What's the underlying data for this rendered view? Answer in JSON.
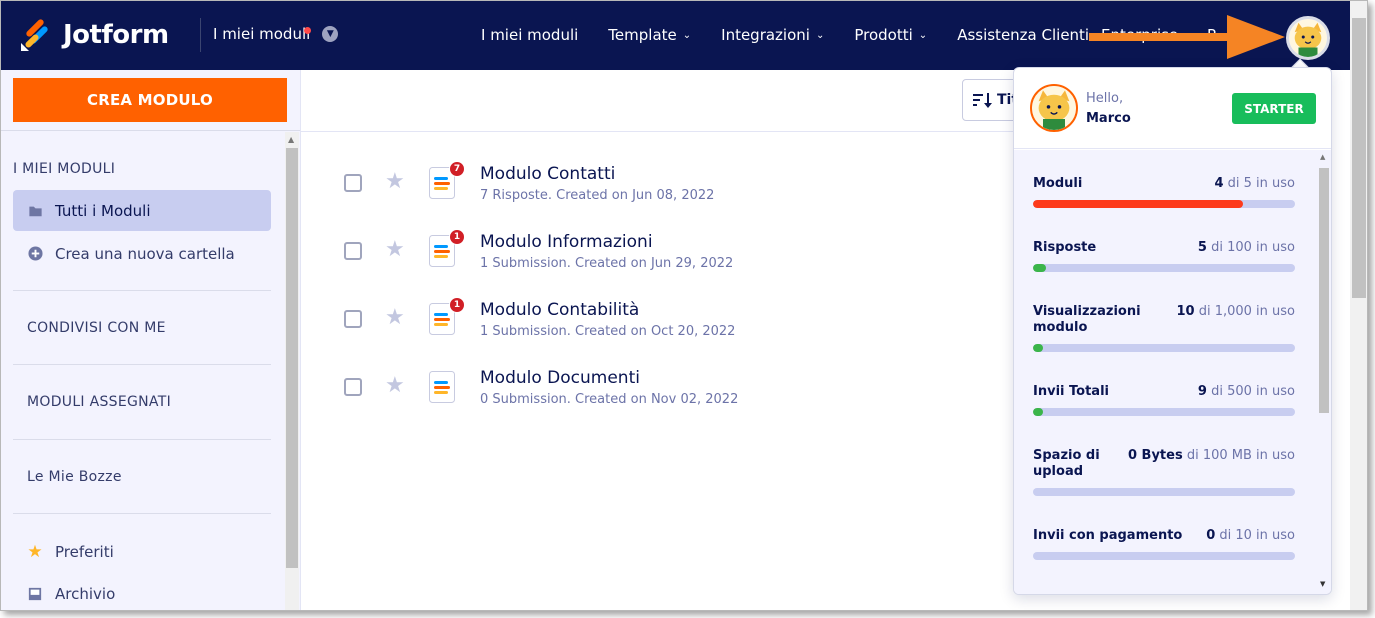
{
  "app": {
    "brand": "Jotform",
    "section_switch": "I miei moduli"
  },
  "nav": {
    "links": [
      {
        "label": "I miei moduli",
        "caret": ""
      },
      {
        "label": "Template",
        "caret": "⌄"
      },
      {
        "label": "Integrazioni",
        "caret": "⌄"
      },
      {
        "label": "Prodotti",
        "caret": "⌄"
      },
      {
        "label": "Assistenza Clienti",
        "caret": "⌄"
      }
    ],
    "partial_links": [
      "Enterprise",
      "P"
    ]
  },
  "sidebar": {
    "create_button": "CREA MODULO",
    "my_forms_heading": "I MIEI MODULI",
    "all_forms": "Tutti i Moduli",
    "new_folder": "Crea una nuova cartella",
    "shared": "CONDIVISI CON ME",
    "assigned": "MODULI ASSEGNATI",
    "drafts": "Le Mie Bozze",
    "favorites": "Preferiti",
    "archive": "Archivio"
  },
  "toolbar": {
    "sort_label": "Titolo"
  },
  "forms": [
    {
      "title": "Modulo Contatti",
      "meta": "7 Risposte. Created on Jun 08, 2022",
      "badge": "7"
    },
    {
      "title": "Modulo Informazioni",
      "meta": "1 Submission. Created on Jun 29, 2022",
      "badge": "1"
    },
    {
      "title": "Modulo Contabilità",
      "meta": "1 Submission. Created on Oct 20, 2022",
      "badge": "1"
    },
    {
      "title": "Modulo Documenti",
      "meta": "0 Submission. Created on Nov 02, 2022",
      "badge": ""
    }
  ],
  "account": {
    "greeting": "Hello,",
    "name": "Marco",
    "plan": "STARTER",
    "usage": [
      {
        "label": "Moduli",
        "used": "4",
        "suffix": " di 5 in uso",
        "fraction": 0.8,
        "color": "#fd3a1b"
      },
      {
        "label": "Risposte",
        "used": "5",
        "suffix": " di 100 in uso",
        "fraction": 0.05,
        "color": "#3bb54a"
      },
      {
        "label": "Visualizzazioni modulo",
        "used": "10",
        "suffix": " di 1,000 in uso",
        "fraction": 0.01,
        "color": "#3bb54a"
      },
      {
        "label": "Invii Totali",
        "used": "9",
        "suffix": " di 500 in uso",
        "fraction": 0.018,
        "color": "#3bb54a"
      },
      {
        "label": "Spazio di upload",
        "used": "0 Bytes",
        "suffix": " di 100 MB in uso",
        "fraction": 0,
        "color": "#3bb54a"
      },
      {
        "label": "Invii con pagamento",
        "used": "0",
        "suffix": " di 10 in uso",
        "fraction": 0,
        "color": "#3bb54a"
      }
    ]
  },
  "colors": {
    "navy": "#0a1551",
    "orange": "#ff6100",
    "green": "#18bd5b",
    "sidebar_bg": "#f3f3fe",
    "active_item": "#c8cdf0",
    "badge_red": "#d11f26",
    "arrow": "#f58424"
  }
}
